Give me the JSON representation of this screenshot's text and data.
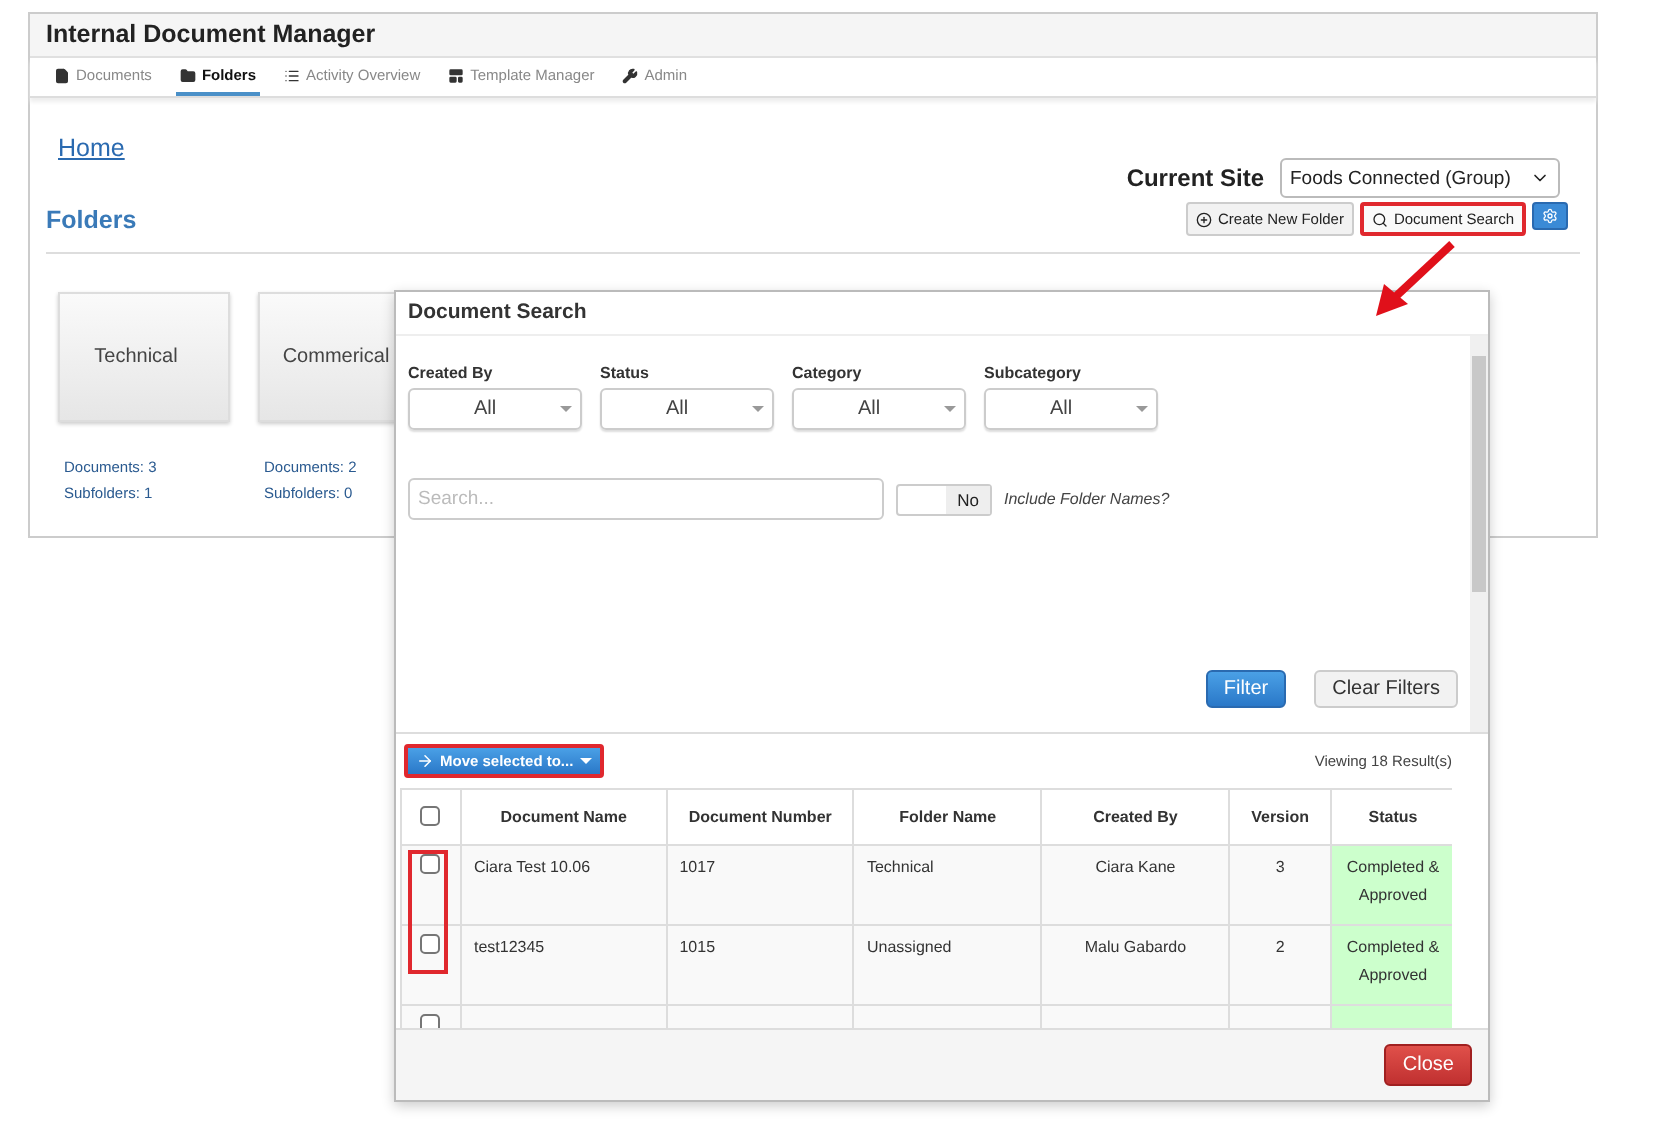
{
  "app": {
    "title": "Internal Document Manager"
  },
  "tabs": [
    {
      "label": "Documents",
      "selected": false
    },
    {
      "label": "Folders",
      "selected": true
    },
    {
      "label": "Activity Overview",
      "selected": false
    },
    {
      "label": "Template Manager",
      "selected": false
    },
    {
      "label": "Admin",
      "selected": false
    }
  ],
  "breadcrumb": "Home",
  "site": {
    "label": "Current Site",
    "value": "Foods Connected (Group)"
  },
  "heading": "Folders",
  "actions": [
    {
      "label": "Create New Folder",
      "highlighted": false
    },
    {
      "label": "Document Search",
      "highlighted": true
    }
  ],
  "folders": [
    {
      "name": "Technical",
      "documents": "Documents: 3",
      "subfolders": "Subfolders: 1"
    },
    {
      "name": "Commerical",
      "documents": "Documents: 2",
      "subfolders": "Subfolders: 0"
    }
  ],
  "dialog": {
    "title": "Document Search",
    "filters": [
      {
        "label": "Created By",
        "value": "All"
      },
      {
        "label": "Status",
        "value": "All"
      },
      {
        "label": "Category",
        "value": "All"
      },
      {
        "label": "Subcategory",
        "value": "All"
      }
    ],
    "search_placeholder": "Search...",
    "toggle": {
      "value": "No",
      "on": false,
      "label": "Include Folder Names?"
    },
    "filter_button": "Filter",
    "clear_button": "Clear Filters",
    "move_button": {
      "label": "Move selected to...",
      "highlighted": true
    },
    "result_count": "Viewing 18 Result(s)",
    "columns": [
      "Document Name",
      "Document Number",
      "Folder Name",
      "Created By",
      "Version",
      "Status"
    ],
    "select_all": false,
    "rows": [
      {
        "checked": false,
        "cells": [
          "Ciara Test 10.06",
          "1017",
          "Technical",
          "Ciara Kane",
          "3"
        ],
        "status": "Completed & Approved",
        "color": "#ccffcc"
      },
      {
        "checked": false,
        "cells": [
          "test12345",
          "1015",
          "Unassigned",
          "Malu Gabardo",
          "2"
        ],
        "status": "Completed & Approved",
        "color": "#ccffcc"
      },
      {
        "checked": false,
        "cells": [],
        "color": "#ccffcc"
      }
    ],
    "highlight_checkboxes": true,
    "close_button": "Close"
  }
}
